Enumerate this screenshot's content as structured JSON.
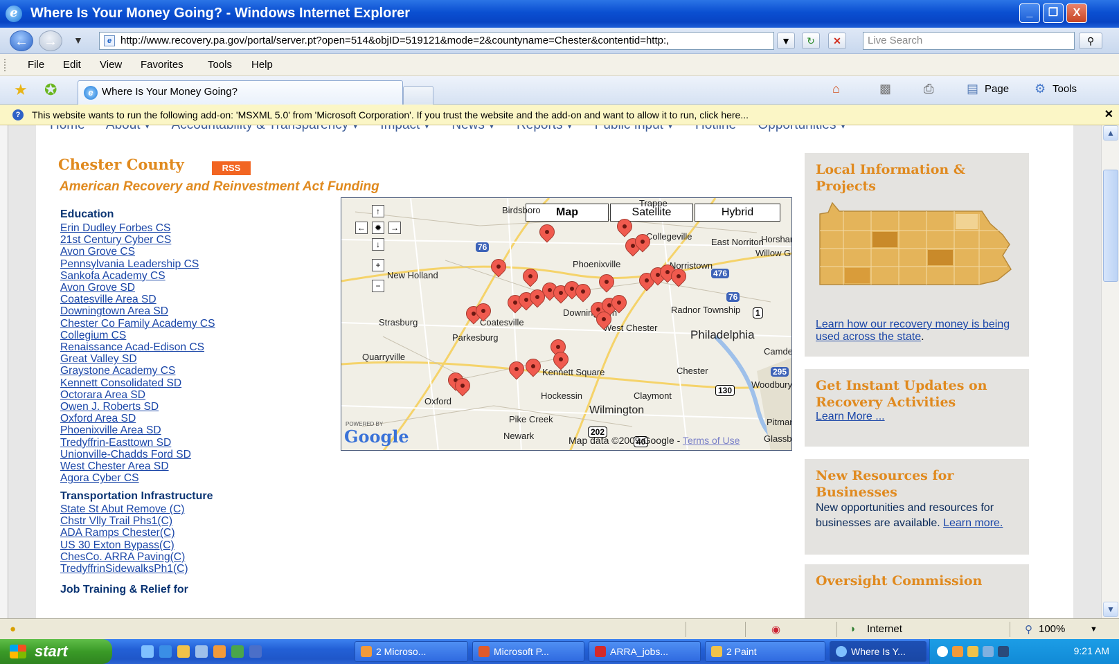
{
  "window": {
    "title": "Where Is Your Money Going? - Windows Internet Explorer",
    "minimize": "_",
    "restore": "❐",
    "close": "X"
  },
  "address": {
    "url": "http://www.recovery.pa.gov/portal/server.pt?open=514&objID=519121&mode=2&countyname=Chester&contentid=http:,",
    "search_placeholder": "Live Search"
  },
  "menu": [
    "File",
    "Edit",
    "View",
    "Favorites",
    "Tools",
    "Help"
  ],
  "tab": {
    "title": "Where Is Your Money Going?"
  },
  "commands": {
    "page": "Page",
    "tools": "Tools"
  },
  "infobar": {
    "message": "This website wants to run the following add-on: 'MSXML 5.0' from 'Microsoft Corporation'. If you trust the website and the add-on and want to allow it to run, click here..."
  },
  "topnav": [
    "Home",
    "About ▾",
    "Accountability & Transparency ▾",
    "Impact ▾",
    "News ▾",
    "Reports ▾",
    "Public Input ▾",
    "Hotline",
    "Opportunities ▾"
  ],
  "county": {
    "title": "Chester County",
    "rss": "RSS",
    "subtitle": "American Recovery and Reinvestment Act Funding"
  },
  "education": {
    "heading": "Education",
    "links": [
      "Erin Dudley Forbes CS",
      "21st Century Cyber CS",
      "Avon Grove CS",
      "Pennsylvania Leadership CS",
      "Sankofa Academy CS",
      "Avon Grove SD",
      "Coatesville Area SD",
      "Downingtown Area SD",
      "Chester Co Family Academy CS",
      "Collegium CS",
      "Renaissance Acad-Edison CS",
      "Great Valley SD",
      "Graystone Academy CS",
      "Kennett Consolidated SD",
      "Octorara Area SD",
      "Owen J. Roberts SD",
      "Oxford Area SD",
      "Phoenixville Area SD",
      "Tredyffrin-Easttown SD",
      "Unionville-Chadds Ford SD",
      "West Chester Area SD",
      "Agora Cyber CS"
    ]
  },
  "transportation": {
    "heading": "Transportation Infrastructure",
    "links": [
      "State St Abut Remove (C)",
      "Chstr Vlly Trail Phs1(C)",
      "ADA Ramps Chester(C)",
      "US 30 Exton Bypass(C)",
      "ChesCo. ARRA Paving(C)",
      "TredyffrinSidewalksPh1(C)"
    ]
  },
  "job_training": {
    "heading": "Job Training & Relief for"
  },
  "map": {
    "type_map": "Map",
    "type_satellite": "Satellite",
    "type_hybrid": "Hybrid",
    "powered_by": "POWERED BY",
    "logo": "Google",
    "attribution": "Map data ©2009 Google - ",
    "terms": "Terms of Use",
    "towns": [
      "Birdsboro",
      "Trappe",
      "Collegeville",
      "East Norriton",
      "Horsham",
      "Willow Grove",
      "Phoenixville",
      "Norristown",
      "New Holland",
      "Strasburg",
      "Coatesville",
      "Downingtown",
      "Radnor Township",
      "Parkesburg",
      "West Chester",
      "Philadelphia",
      "Quarryville",
      "Kennett Square",
      "Chester",
      "Camden",
      "Woodbury",
      "Hockessin",
      "Claymont",
      "Oxford",
      "Wilmington",
      "Pike Creek",
      "Pitman",
      "Newark",
      "Glassboro"
    ],
    "shields": [
      "76",
      "476",
      "76",
      "1",
      "295",
      "130",
      "202",
      "40"
    ]
  },
  "right": {
    "local_title": "Local Information & Projects",
    "local_link": "Learn how our recovery money is being used across the state",
    "updates_title": "Get Instant Updates on Recovery Activities",
    "updates_link": "Learn More ...",
    "business_title": "New Resources for Businesses",
    "business_text": "New opportunities and resources for businesses are available. ",
    "business_link": "Learn more.",
    "oversight_title": "Oversight Commission"
  },
  "status": {
    "zone": "Internet",
    "zoom": "100%"
  },
  "taskbar": {
    "start": "start",
    "tasks": [
      "2 Microso...",
      "Microsoft P...",
      "ARRA_jobs...",
      "2 Paint",
      "Where Is Y..."
    ],
    "clock": "9:21 AM"
  }
}
